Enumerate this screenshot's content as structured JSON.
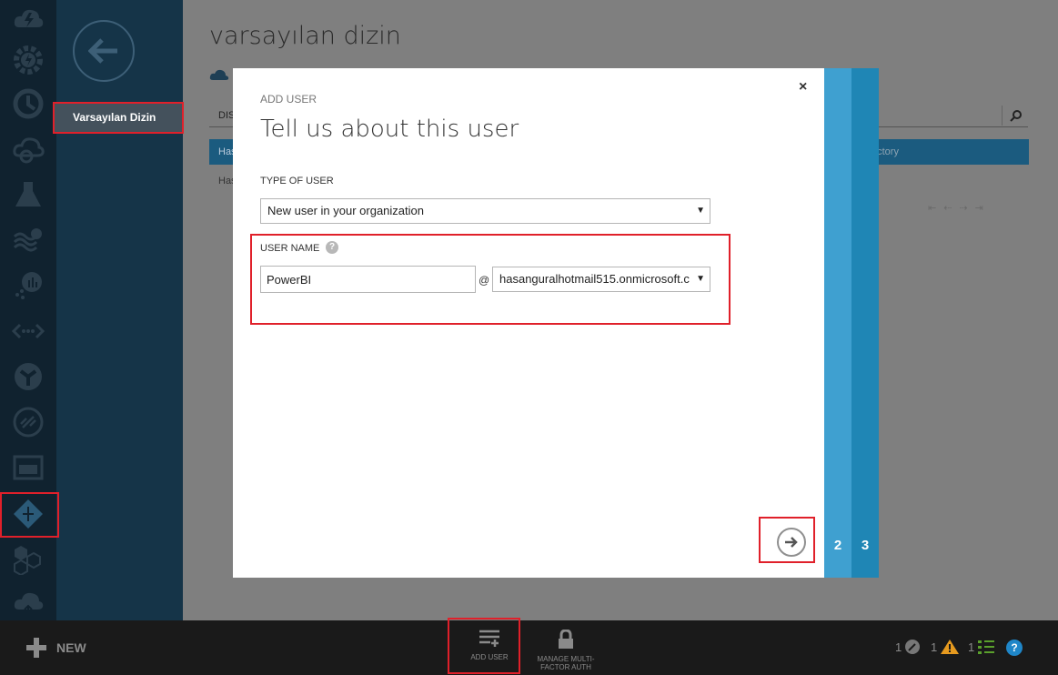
{
  "page": {
    "title": "varsayılan dizin",
    "nav_item": "Varsayılan Dizin",
    "tab_label": "DIS",
    "header_left": "Has",
    "header_right": "ectory",
    "row_label": "Has"
  },
  "modal": {
    "kicker": "ADD USER",
    "title": "Tell us about this user",
    "type_label": "TYPE OF USER",
    "type_value": "New user in your organization",
    "username_label": "USER NAME",
    "help_glyph": "?",
    "username_value": "PowerBI",
    "at_sign": "@",
    "domain_value": "hasanguralhotmail515.onmicrosoft.c",
    "close_glyph": "×"
  },
  "steps": [
    "2",
    "3"
  ],
  "bottombar": {
    "new_label": "NEW",
    "add_user_label": "ADD USER",
    "mfa_label_1": "MANAGE MULTI-",
    "mfa_label_2": "FACTOR AUTH",
    "status_tools": "1",
    "status_warning": "1",
    "status_list": "1",
    "help_glyph": "?"
  },
  "icons": [
    "cloud-lightning-icon",
    "gear-lightning-icon",
    "clock-icon",
    "cloud-sync-icon",
    "flask-icon",
    "gears-wave-icon",
    "chart-dots-icon",
    "code-brackets-icon",
    "service-icon",
    "remote-app-icon",
    "storage-icon",
    "active-directory-icon",
    "hexagons-icon",
    "cloud-upload-icon"
  ],
  "colors": {
    "accent": "#3fa3d3",
    "step2": "#3fa0d0",
    "step3": "#1f86b5",
    "highlight": "#e0202a"
  }
}
